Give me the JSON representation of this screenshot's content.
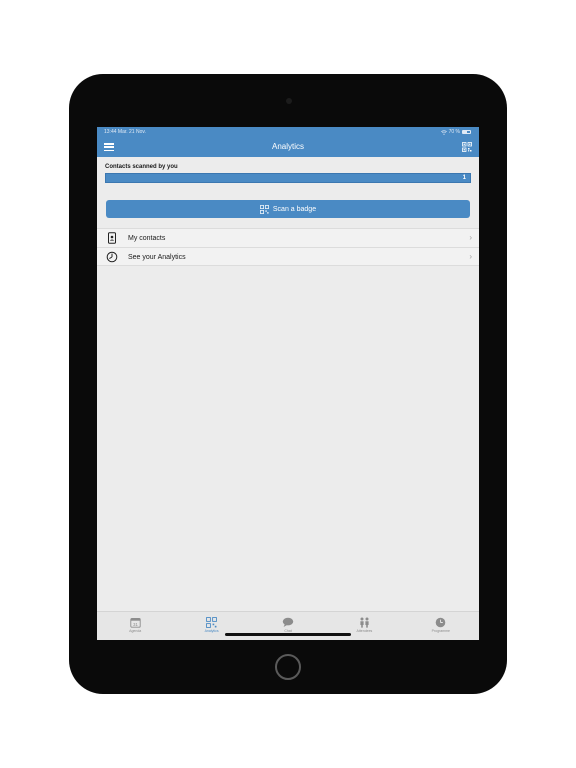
{
  "status_bar": {
    "time_date": "13:44   Mar. 21 Nov.",
    "battery": "70 %"
  },
  "nav": {
    "title": "Analytics"
  },
  "stats": {
    "title": "Contacts scanned by you",
    "count": "1"
  },
  "scan_button": {
    "label": "Scan a badge"
  },
  "list": [
    {
      "label": "My contacts",
      "icon": "contact-device-icon"
    },
    {
      "label": "See your Analytics",
      "icon": "clock-chart-icon"
    }
  ],
  "tabs": [
    {
      "label": "Agenda",
      "icon": "calendar-icon"
    },
    {
      "label": "Analytics",
      "icon": "qr-code-icon",
      "active": true
    },
    {
      "label": "Chat",
      "icon": "chat-icon"
    },
    {
      "label": "Attendees",
      "icon": "attendees-icon"
    },
    {
      "label": "Programme",
      "icon": "clock-icon"
    }
  ],
  "colors": {
    "accent": "#4a8ac4",
    "background": "#ececec"
  }
}
